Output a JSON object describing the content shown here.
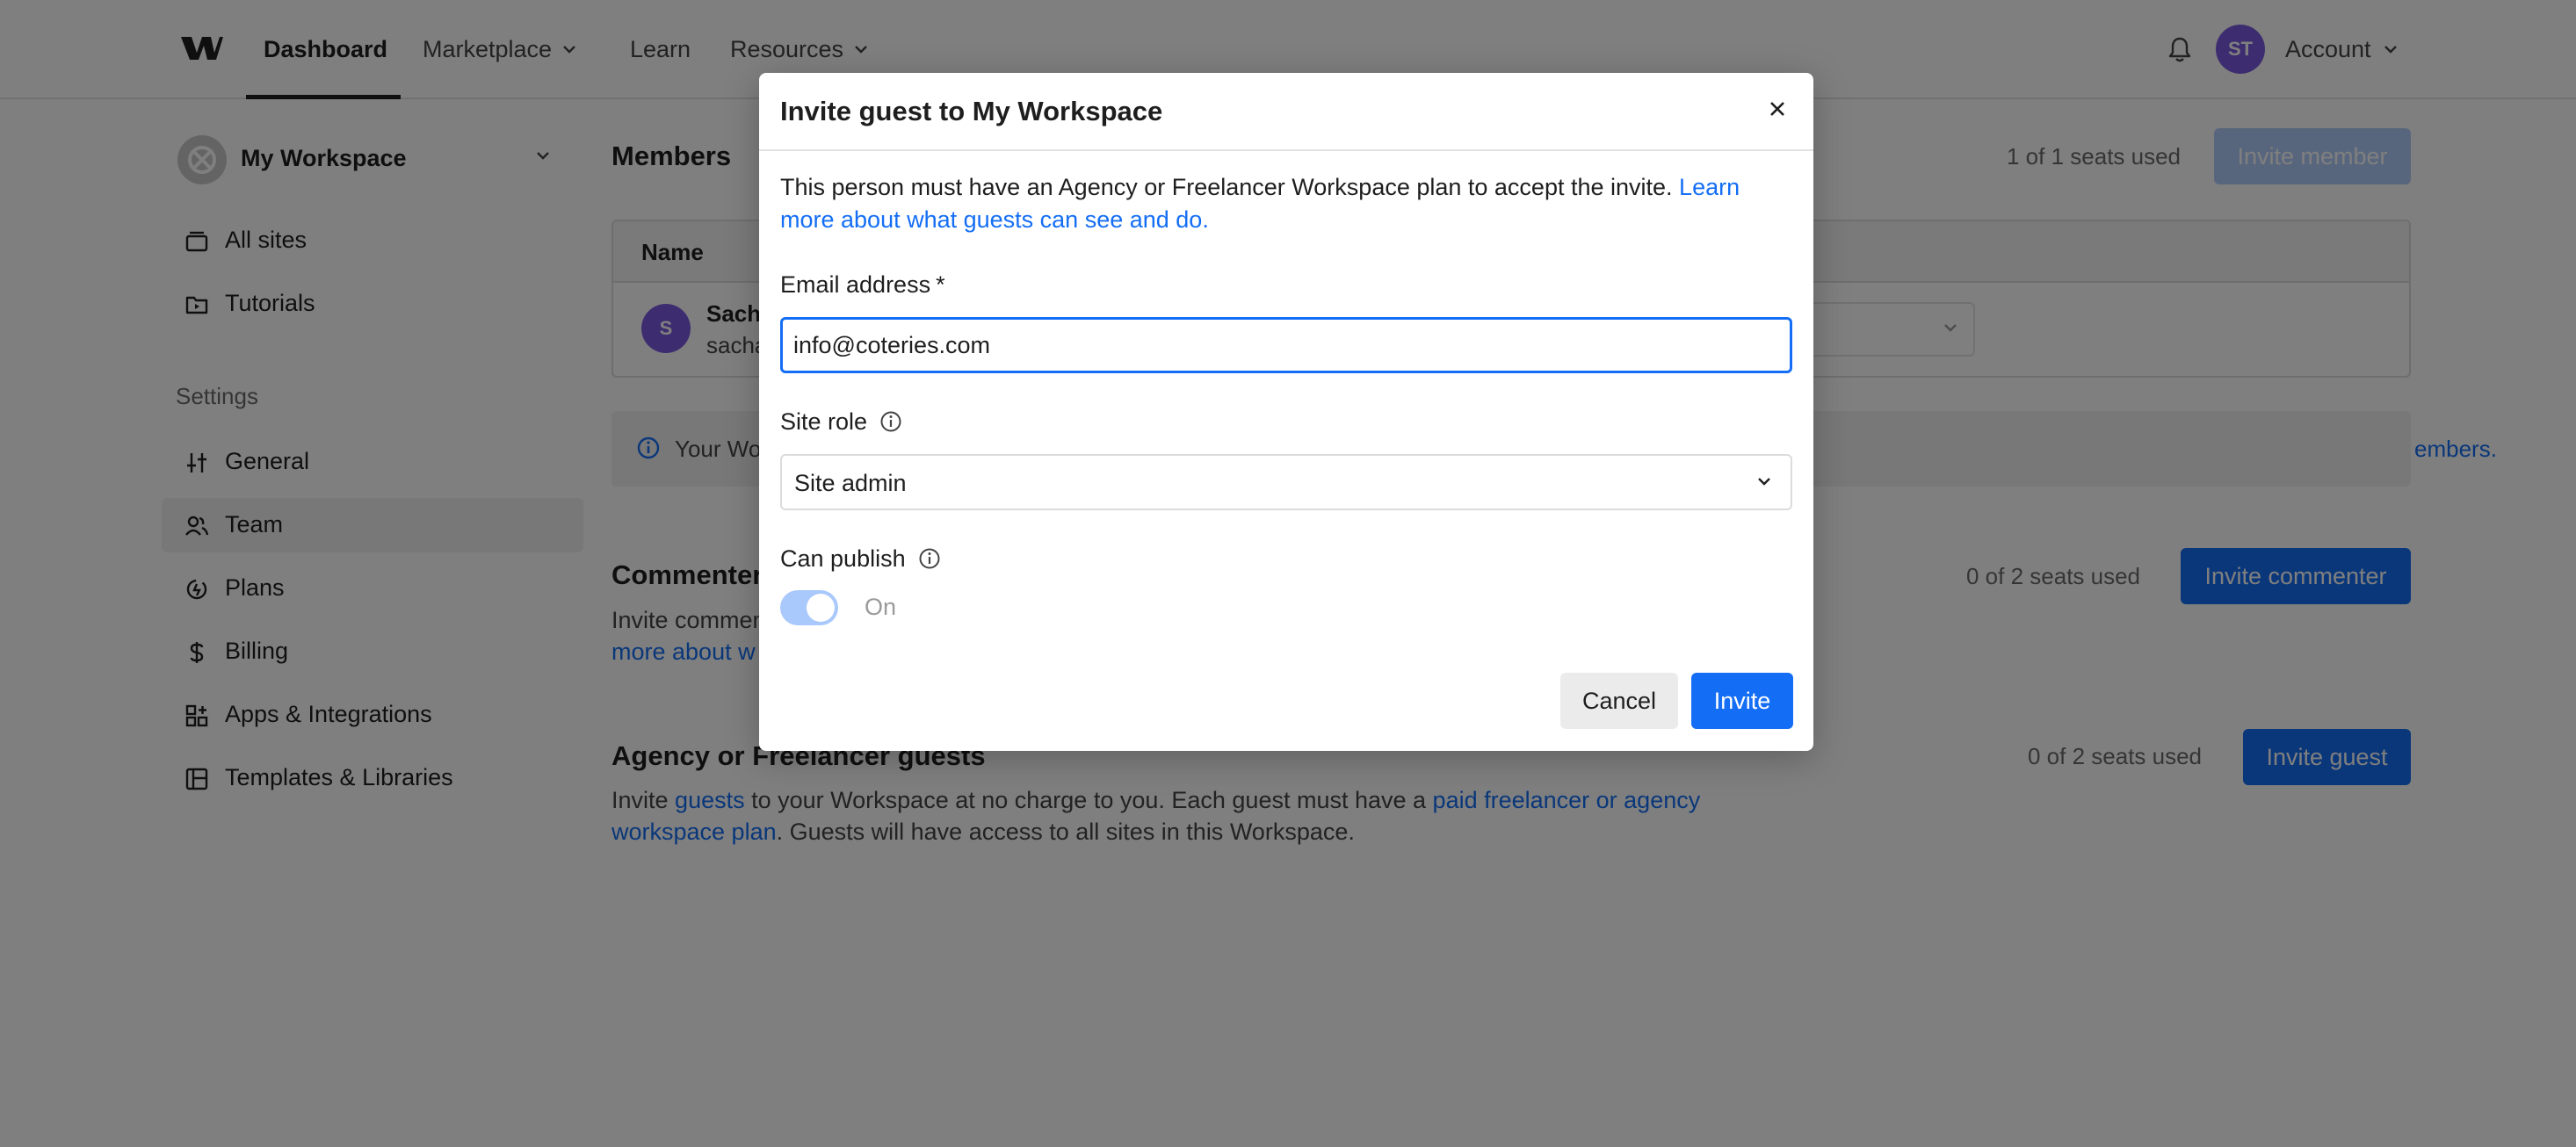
{
  "nav": {
    "items": [
      {
        "label": "Dashboard"
      },
      {
        "label": "Marketplace"
      },
      {
        "label": "Learn"
      },
      {
        "label": "Resources"
      }
    ],
    "avatar_initials": "ST",
    "account_label": "Account"
  },
  "sidebar": {
    "workspace_name": "My Workspace",
    "items": [
      {
        "label": "All sites",
        "icon": "sites-icon"
      },
      {
        "label": "Tutorials",
        "icon": "tutorials-icon"
      }
    ],
    "settings_heading": "Settings",
    "settings_items": [
      {
        "label": "General",
        "icon": "sliders-icon"
      },
      {
        "label": "Team",
        "icon": "team-icon"
      },
      {
        "label": "Plans",
        "icon": "plans-icon"
      },
      {
        "label": "Billing",
        "icon": "dollar-icon"
      },
      {
        "label": "Apps & Integrations",
        "icon": "apps-icon"
      },
      {
        "label": "Templates & Libraries",
        "icon": "templates-icon"
      }
    ],
    "active_item": "Team"
  },
  "members": {
    "title": "Members",
    "seats": "1 of 1 seats used",
    "invite_button": "Invite member",
    "table": {
      "col_name": "Name",
      "row": {
        "avatar": "S",
        "name": "Sach",
        "email": "sacha"
      }
    },
    "notice_text": "Your Wo",
    "notice_link": "embers."
  },
  "commenters": {
    "title": "Commenter",
    "seats": "0 of 2 seats used",
    "invite_button": "Invite commenter",
    "text_line1": "Invite commen",
    "text_link": "more about w"
  },
  "guests": {
    "title": "Agency or Freelancer guests",
    "seats": "0 of 2 seats used",
    "invite_button": "Invite guest",
    "text_pre": "Invite ",
    "link1": "guests",
    "text_mid": " to your Workspace at no charge to you. Each guest must have a ",
    "link2": "paid freelancer or agency workspace plan",
    "text_post": ". Guests will have access to all sites in this Workspace."
  },
  "modal": {
    "title": "Invite guest to My Workspace",
    "description": "This person must have an Agency or Freelancer Workspace plan to accept the invite. ",
    "description_link": "Learn more about what guests can see and do.",
    "email_label": "Email address",
    "email_required": "*",
    "email_value": "info@coteries.com",
    "site_role_label": "Site role",
    "site_role_value": "Site admin",
    "can_publish_label": "Can publish",
    "can_publish_state": "On",
    "cancel_label": "Cancel",
    "invite_label": "Invite"
  },
  "colors": {
    "accent": "#146ef5",
    "avatar": "#7a5ae0",
    "overlay": "rgba(0,0,0,0.5)"
  }
}
